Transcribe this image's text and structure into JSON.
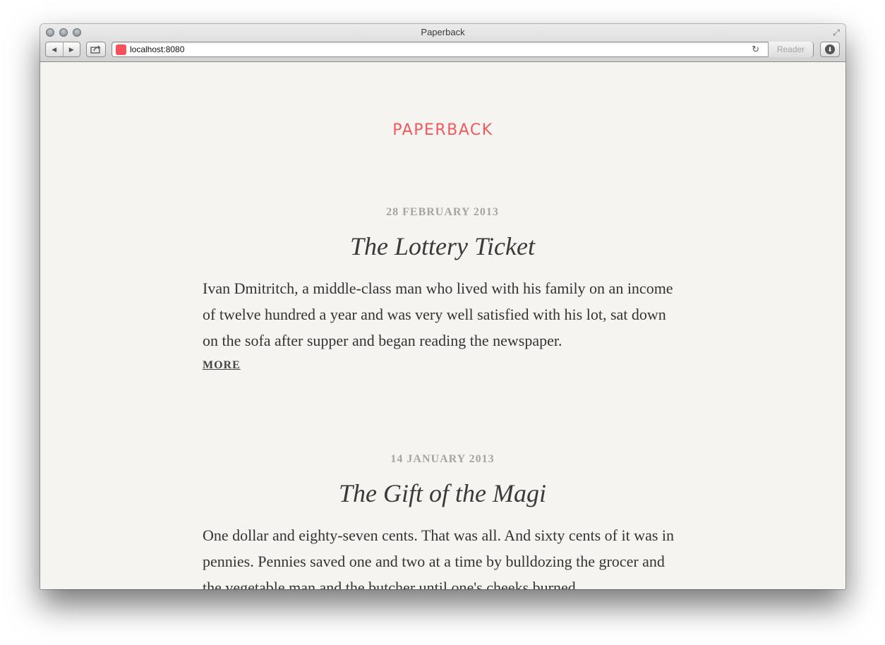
{
  "window": {
    "title": "Paperback",
    "url": "localhost:8080",
    "reader_label": "Reader",
    "back_icon": "◀",
    "forward_icon": "▶"
  },
  "site": {
    "title": "PAPERBACK",
    "accent": "#f05a5f"
  },
  "posts": [
    {
      "date": "28 FEBRUARY 2013",
      "title": "The Lottery Ticket",
      "excerpt": "Ivan Dmitritch, a middle-class man who lived with his family on an income of twelve hundred a year and was very well satisfied with his lot, sat down on the sofa after supper and began reading the newspaper.",
      "more": "MORE"
    },
    {
      "date": "14 JANUARY 2013",
      "title": "The Gift of the Magi",
      "excerpt": "One dollar and eighty-seven cents. That was all. And sixty cents of it was in pennies. Pennies saved one and two at a time by bulldozing the grocer and the vegetable man and the butcher until one's cheeks burned"
    }
  ]
}
